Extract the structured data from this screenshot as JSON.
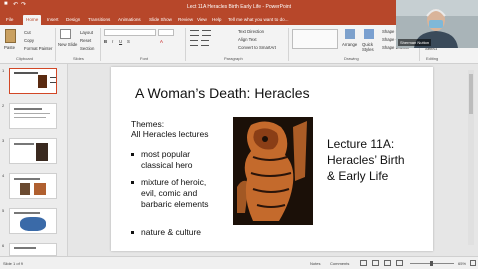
{
  "window": {
    "title": "Lect 11A Heracles Birth Early Life  -  PowerPoint"
  },
  "tabs": [
    "File",
    "Home",
    "Insert",
    "Design",
    "Transitions",
    "Animations",
    "Slide Show",
    "Review",
    "View",
    "Help",
    "Tell me what you want to do..."
  ],
  "ribbon": {
    "clipboard": {
      "paste": "Paste",
      "cut": "Cut",
      "copy": "Copy",
      "format_painter": "Format Painter",
      "group": "Clipboard"
    },
    "slides": {
      "new_slide": "New Slide",
      "layout": "Layout",
      "reset": "Reset",
      "section": "Section",
      "group": "Slides"
    },
    "font": {
      "group": "Font"
    },
    "paragraph": {
      "text_direction": "Text Direction",
      "align_text": "Align Text",
      "smartart": "Convert to SmartArt",
      "group": "Paragraph"
    },
    "drawing": {
      "arrange": "Arrange",
      "quick_styles": "Quick Styles",
      "shape_fill": "Shape Fill",
      "shape_outline": "Shape Outline",
      "shape_effects": "Shape Effects",
      "group": "Drawing"
    },
    "editing": {
      "select": "Select",
      "group": "Editing"
    }
  },
  "thumbnails": [
    "1",
    "2",
    "3",
    "4",
    "5",
    "6"
  ],
  "slide": {
    "title": "A Woman’s Death: Heracles",
    "themes_line1": "Themes:",
    "themes_line2": "All Heracles lectures",
    "bullets": [
      {
        "line1": "most popular",
        "line2": "classical hero"
      },
      {
        "line1": "mixture of heroic,",
        "line2": "evil, comic and",
        "line3": "barbaric elements"
      },
      {
        "line1": "nature & culture"
      }
    ],
    "lecture_line1": "Lecture 11A:",
    "lecture_line2": "Heracles’ Birth",
    "lecture_line3": "& Early Life"
  },
  "status": {
    "slide_count": "Slide 1 of 9",
    "notes": "Notes",
    "comments": "Comments",
    "zoom": "65%"
  },
  "video": {
    "name": "Sherman Nutton"
  },
  "colors": {
    "accent": "#b7472a",
    "selection": "#d24726"
  }
}
